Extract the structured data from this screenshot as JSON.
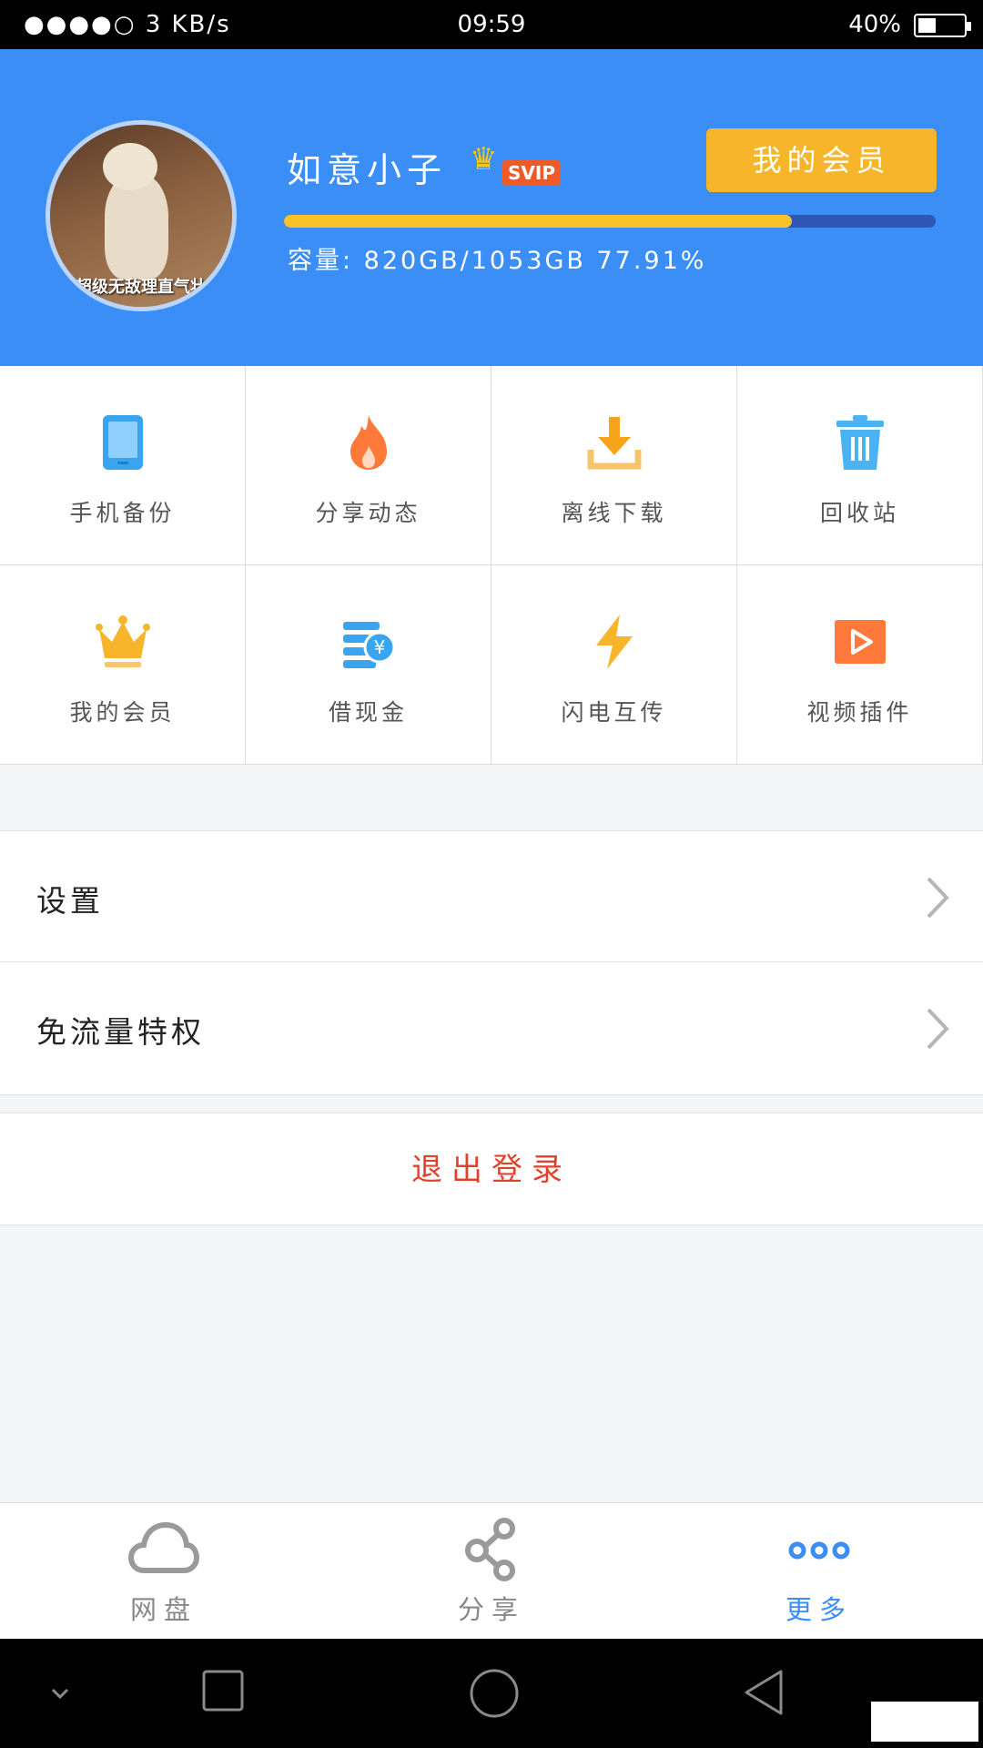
{
  "status_bar": {
    "signal": "●●●●○ 3 KB/s",
    "time": "09:59",
    "battery_pct": "40%",
    "battery_level": 0.4
  },
  "header": {
    "avatar_caption": "超级无敌理直气壮",
    "username": "如意小子",
    "badge": "SVIP",
    "member_button": "我的会员",
    "capacity_text": "容量: 820GB/1053GB 77.91%",
    "capacity_fraction": 0.7791,
    "progress_color": "#f7c22a",
    "bg_color": "#3a8ef6"
  },
  "grid": [
    {
      "label": "手机备份",
      "icon": "phone-icon"
    },
    {
      "label": "分享动态",
      "icon": "flame-icon"
    },
    {
      "label": "离线下载",
      "icon": "download-icon"
    },
    {
      "label": "回收站",
      "icon": "trash-icon"
    },
    {
      "label": "我的会员",
      "icon": "crown-icon"
    },
    {
      "label": "借现金",
      "icon": "cash-icon"
    },
    {
      "label": "闪电互传",
      "icon": "lightning-icon"
    },
    {
      "label": "视频插件",
      "icon": "video-play-icon"
    }
  ],
  "list": {
    "settings": "设置",
    "free_traffic": "免流量特权"
  },
  "logout": "退出登录",
  "tabs": [
    {
      "label": "网盘",
      "icon": "cloud-icon",
      "active": false
    },
    {
      "label": "分享",
      "icon": "share-icon",
      "active": false
    },
    {
      "label": "更多",
      "icon": "more-dots-icon",
      "active": true
    }
  ],
  "navbar": {
    "icons": [
      "chevron-down-icon",
      "recent-apps-icon",
      "home-icon",
      "back-icon"
    ]
  }
}
